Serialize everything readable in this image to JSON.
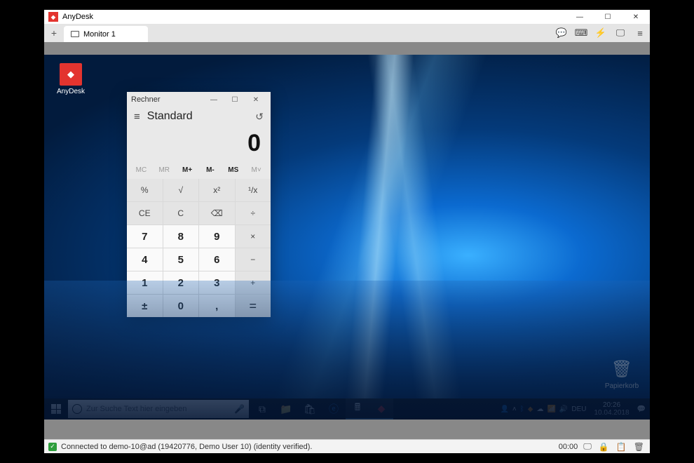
{
  "anydesk": {
    "title": "AnyDesk",
    "tab_label": "Monitor 1",
    "status_text": "Connected to demo-10@ad (19420776, Demo User 10) (identity verified).",
    "status_time": "00:00"
  },
  "desktop": {
    "icon_anydesk": "AnyDesk",
    "icon_bin": "Papierkorb"
  },
  "calc": {
    "title": "Rechner",
    "mode": "Standard",
    "display": "0",
    "mem": [
      "MC",
      "MR",
      "M+",
      "M-",
      "MS",
      "M˅"
    ],
    "keys_fn1": [
      "%",
      "√",
      "x²",
      "¹/x"
    ],
    "keys_fn2": [
      "CE",
      "C",
      "⌫",
      "÷"
    ],
    "row1": [
      "7",
      "8",
      "9",
      "×"
    ],
    "row2": [
      "4",
      "5",
      "6",
      "−"
    ],
    "row3": [
      "1",
      "2",
      "3",
      "+"
    ],
    "row4": [
      "±",
      "0",
      ",",
      "="
    ]
  },
  "taskbar": {
    "search_placeholder": "Zur Suche Text hier eingeben",
    "lang": "DEU",
    "time": "20:26",
    "date": "10.04.2018"
  }
}
